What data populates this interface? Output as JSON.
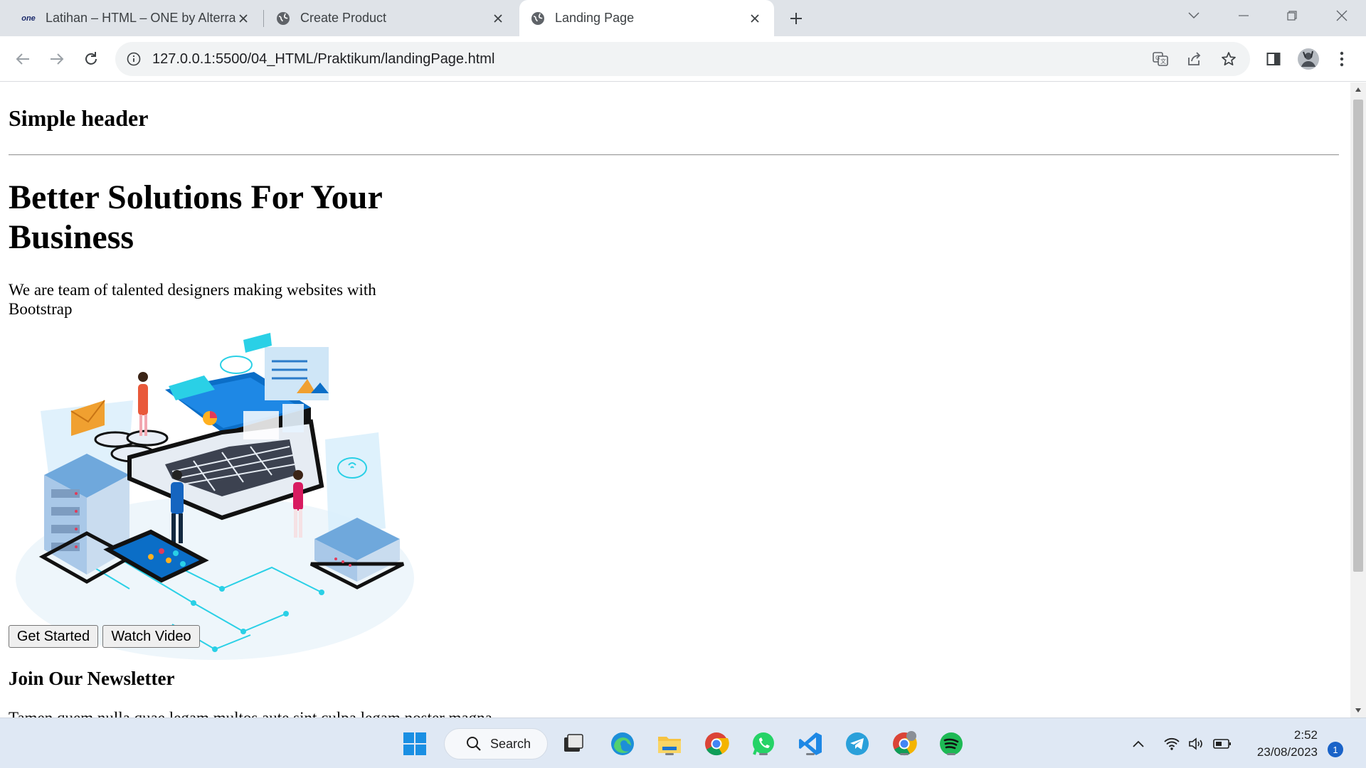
{
  "browser": {
    "tabs": [
      {
        "title": "Latihan – HTML – ONE by Alterra",
        "favicon": "alterra-logo"
      },
      {
        "title": "Create Product",
        "favicon": "globe-icon"
      },
      {
        "title": "Landing Page",
        "favicon": "globe-icon",
        "active": true
      }
    ],
    "url": "127.0.0.1:5500/04_HTML/Praktikum/landingPage.html",
    "favicon_text": "one"
  },
  "page": {
    "header": "Simple header",
    "hero_title": "Better Solutions For Your Business",
    "hero_description": "We are team of talented designers making websites with Bootstrap",
    "buttons": {
      "get_started": "Get Started",
      "watch_video": "Watch Video"
    },
    "newsletter_title": "Join Our Newsletter",
    "newsletter_text": "Tamen quem nulla quae legam multos aute sint culpa legam noster magna"
  },
  "taskbar": {
    "search_label": "Search",
    "apps": [
      "start-icon",
      "search-icon",
      "task-view-icon",
      "edge-icon",
      "file-explorer-icon",
      "chrome-icon",
      "whatsapp-icon",
      "vscode-icon",
      "telegram-icon",
      "chrome-profile-icon",
      "spotify-icon"
    ],
    "time": "2:52",
    "date": "23/08/2023",
    "notifications": "1"
  }
}
